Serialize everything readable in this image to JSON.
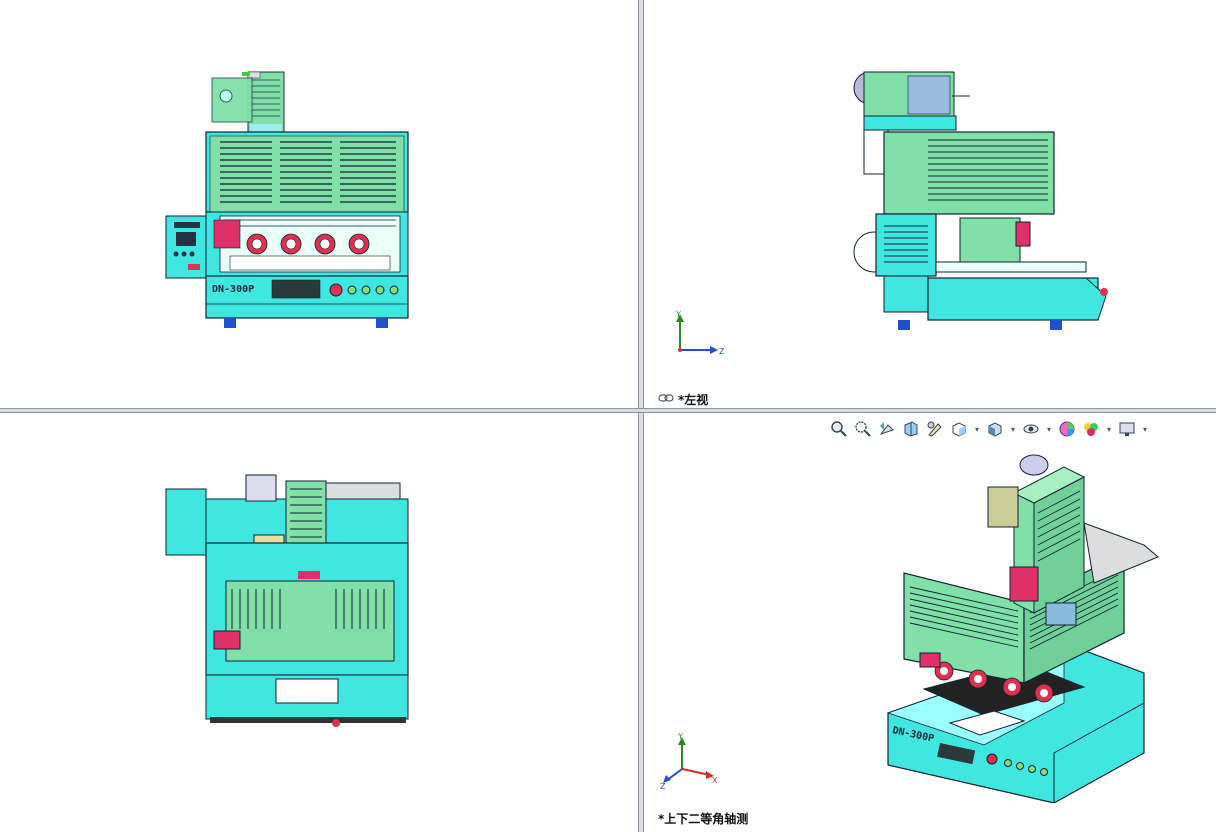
{
  "viewports": {
    "left_view_label": "*左视",
    "iso_view_label": "*上下二等角轴测"
  },
  "machine": {
    "model_label": "DN-300P"
  },
  "triad": {
    "y": "Y",
    "z": "Z",
    "x": "X"
  },
  "toolbar": {
    "icons": [
      "zoom-to-fit-icon",
      "zoom-area-icon",
      "previous-view-icon",
      "section-view-icon",
      "dynamic-annotation-icon",
      "view-orientation-icon",
      "display-style-icon",
      "hide-show-items-icon",
      "edit-appearance-icon",
      "apply-scene-icon",
      "view-settings-icon"
    ]
  },
  "colors": {
    "cyan_body": "#40e6e0",
    "green_cover": "#80e0a8",
    "red_knob": "#e03050",
    "magenta_block": "#e0306a",
    "blue_feet": "#2050d0"
  }
}
